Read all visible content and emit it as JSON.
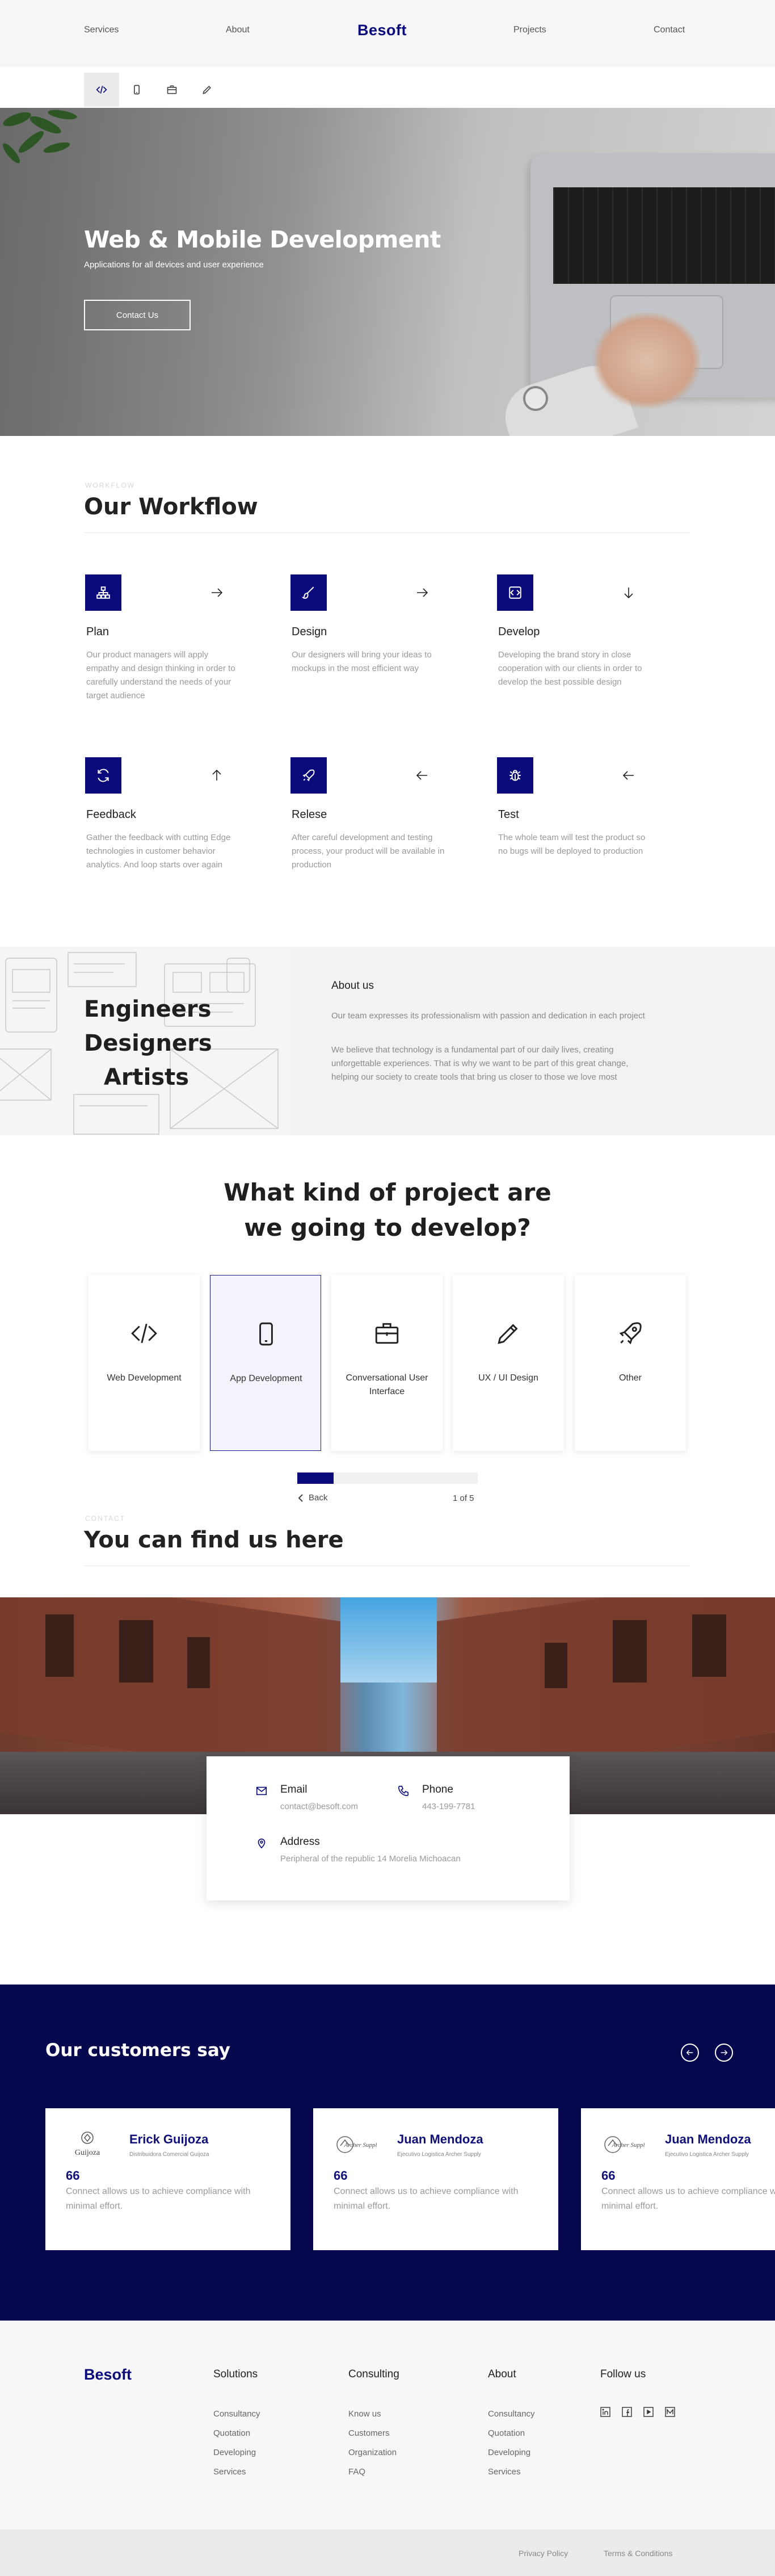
{
  "nav": {
    "brand": "Besoft",
    "links": [
      "Services",
      "About",
      "Projects",
      "Contact"
    ]
  },
  "service_tabs": [
    "code-icon",
    "mobile-icon",
    "briefcase-icon",
    "pen-icon"
  ],
  "hero": {
    "title": "Web & Mobile Development",
    "subtitle": "Applications for all devices and user experience",
    "cta": "Contact Us"
  },
  "workflow": {
    "kicker": "WORKFLOW",
    "title": "Our Workflow",
    "steps": [
      {
        "icon": "sitemap-icon",
        "arrow": "arrow-right",
        "title": "Plan",
        "desc": "Our product managers will apply empathy and design thinking in order to carefully understand the needs of your target audience"
      },
      {
        "icon": "paintbrush-icon",
        "arrow": "arrow-right",
        "title": "Design",
        "desc": "Our designers will bring your ideas to mockups in the most efficient way"
      },
      {
        "icon": "code-icon",
        "arrow": "arrow-down",
        "title": "Develop",
        "desc": "Developing the brand story in close cooperation with our clients in order to develop the best possible design"
      },
      {
        "icon": "refresh-icon",
        "arrow": "arrow-up",
        "title": "Feedback",
        "desc": "Gather the feedback with cutting Edge technologies in customer behavior analytics. And loop starts over again"
      },
      {
        "icon": "rocket-icon",
        "arrow": "arrow-left",
        "title": "Relese",
        "desc": "After careful development and testing process, your product will be available in production"
      },
      {
        "icon": "bug-icon",
        "arrow": "arrow-left",
        "title": "Test",
        "desc": "The whole team will test the product so no bugs will be deployed to production"
      }
    ]
  },
  "about": {
    "words": [
      "Engineers",
      "Designers",
      "Artists"
    ],
    "heading": "About us",
    "p1": "Our team expresses its professionalism with passion and dedication in each project",
    "p2": "We believe that technology is a fundamental part of our daily lives, creating unforgettable experiences. That is why we want to be part of this great change, helping our society to create tools that bring us closer to those we love most"
  },
  "project": {
    "title_line1": "What kind of project are",
    "title_line2": "we going to develop?",
    "options": [
      {
        "icon": "code-icon",
        "label": "Web Development"
      },
      {
        "icon": "mobile-icon",
        "label": "App Development"
      },
      {
        "icon": "briefcase-icon",
        "label": "Conversational User Interface"
      },
      {
        "icon": "pen-icon",
        "label": "UX / UI Design"
      },
      {
        "icon": "rocket-icon",
        "label": "Other"
      }
    ],
    "selected_index": 1,
    "progress": 0.2,
    "back": "Back",
    "step_counter": "1 of 5"
  },
  "findus": {
    "kicker": "CONTACT",
    "title": "You can find us here",
    "email_label": "Email",
    "email_value": "contact@besoft.com",
    "phone_label": "Phone",
    "phone_value": "443-199-7781",
    "address_label": "Address",
    "address_value": "Peripheral of the republic 14 Morelia Michoacan"
  },
  "testimonials": {
    "title": "Our customers say",
    "items": [
      {
        "logo": "Guijoza",
        "name": "Erick Guijoza",
        "role": "Distribuidora Comercial Guijoza",
        "quote": "66",
        "text": "Connect allows us to achieve compliance with minimal effort."
      },
      {
        "logo": "Archer Supply",
        "name": "Juan Mendoza",
        "role": "Ejecutivo Logistica Archer Supply",
        "quote": "66",
        "text": "Connect allows us to achieve compliance with minimal effort."
      },
      {
        "logo": "Archer Supply",
        "name": "Juan Mendoza",
        "role": "Ejecutivo Logistica Archer Supply",
        "quote": "66",
        "text": "Connect allows us to achieve compliance with minimal effort."
      }
    ]
  },
  "footer": {
    "brand": "Besoft",
    "columns": [
      {
        "title": "Solutions",
        "links": [
          "Consultancy",
          "Quotation",
          "Developing",
          "Services"
        ]
      },
      {
        "title": "Consulting",
        "links": [
          "Know us",
          "Customers",
          "Organization",
          "FAQ"
        ]
      },
      {
        "title": "About",
        "links": [
          "Consultancy",
          "Quotation",
          "Developing",
          "Services"
        ]
      }
    ],
    "follow": "Follow us",
    "socials": [
      "linkedin-icon",
      "facebook-icon",
      "youtube-icon",
      "medium-icon"
    ],
    "privacy": "Privacy Policy",
    "terms": "Terms & Conditions"
  },
  "colors": {
    "brand": "#0a0a7a",
    "testimonial_bg": "#08084e",
    "muted_text": "#9a9a9a"
  }
}
